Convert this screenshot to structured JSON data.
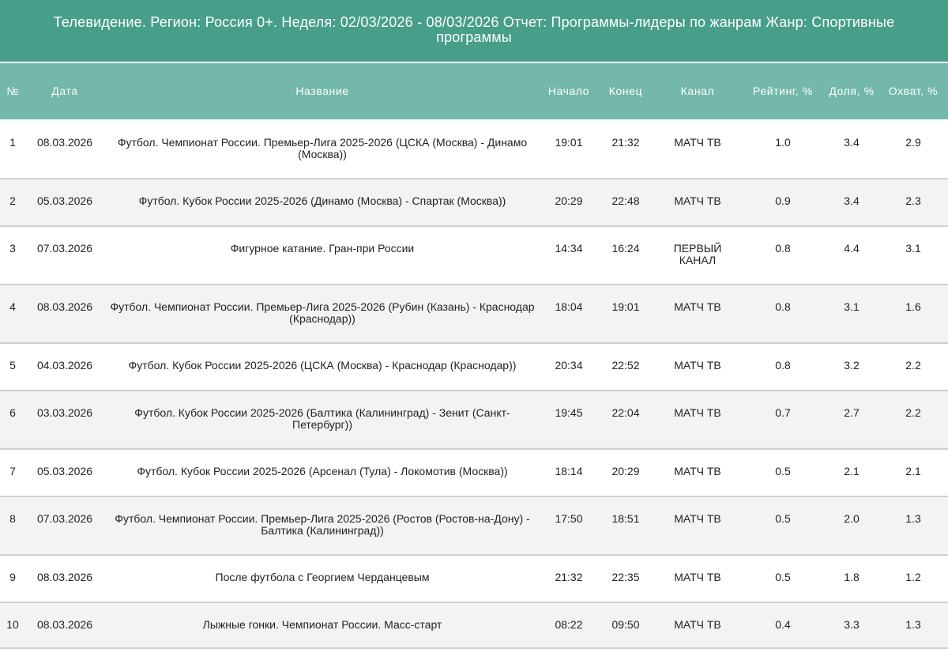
{
  "title": "Телевидение. Регион: Россия 0+. Неделя: 02/03/2026 - 08/03/2026 Отчет: Программы-лидеры по жанрам Жанр: Спортивные программы",
  "colors": {
    "title_bg": "#479f8a",
    "header_bg": "#73b8aa",
    "row_alt_bg": "#f3f3f3",
    "divider": "#d0d0d0"
  },
  "columns": {
    "num": "№",
    "date": "Дата",
    "name": "Название",
    "start": "Начало",
    "end": "Конец",
    "channel": "Канал",
    "rating": "Рейтинг, %",
    "share": "Доля, %",
    "reach": "Охват, %"
  },
  "rows": [
    {
      "num": "1",
      "date": "08.03.2026",
      "name": "Футбол. Чемпионат России. Премьер-Лига 2025-2026 (ЦСКА (Москва) - Динамо (Москва))",
      "start": "19:01",
      "end": "21:32",
      "channel": "МАТЧ ТВ",
      "rating": "1.0",
      "share": "3.4",
      "reach": "2.9"
    },
    {
      "num": "2",
      "date": "05.03.2026",
      "name": "Футбол. Кубок России 2025-2026 (Динамо (Москва) - Спартак (Москва))",
      "start": "20:29",
      "end": "22:48",
      "channel": "МАТЧ ТВ",
      "rating": "0.9",
      "share": "3.4",
      "reach": "2.3"
    },
    {
      "num": "3",
      "date": "07.03.2026",
      "name": "Фигурное катание. Гран-при России",
      "start": "14:34",
      "end": "16:24",
      "channel": "ПЕРВЫЙ КАНАЛ",
      "rating": "0.8",
      "share": "4.4",
      "reach": "3.1"
    },
    {
      "num": "4",
      "date": "08.03.2026",
      "name": "Футбол. Чемпионат России. Премьер-Лига 2025-2026 (Рубин (Казань) - Краснодар (Краснодар))",
      "start": "18:04",
      "end": "19:01",
      "channel": "МАТЧ ТВ",
      "rating": "0.8",
      "share": "3.1",
      "reach": "1.6"
    },
    {
      "num": "5",
      "date": "04.03.2026",
      "name": "Футбол. Кубок России 2025-2026 (ЦСКА (Москва) - Краснодар (Краснодар))",
      "start": "20:34",
      "end": "22:52",
      "channel": "МАТЧ ТВ",
      "rating": "0.8",
      "share": "3.2",
      "reach": "2.2"
    },
    {
      "num": "6",
      "date": "03.03.2026",
      "name": "Футбол. Кубок России 2025-2026 (Балтика (Калининград) - Зенит (Санкт-Петербург))",
      "start": "19:45",
      "end": "22:04",
      "channel": "МАТЧ ТВ",
      "rating": "0.7",
      "share": "2.7",
      "reach": "2.2"
    },
    {
      "num": "7",
      "date": "05.03.2026",
      "name": "Футбол. Кубок России 2025-2026 (Арсенал (Тула) - Локомотив (Москва))",
      "start": "18:14",
      "end": "20:29",
      "channel": "МАТЧ ТВ",
      "rating": "0.5",
      "share": "2.1",
      "reach": "2.1"
    },
    {
      "num": "8",
      "date": "07.03.2026",
      "name": "Футбол. Чемпионат России. Премьер-Лига 2025-2026 (Ростов (Ростов-на-Дону) - Балтика (Калининград))",
      "start": "17:50",
      "end": "18:51",
      "channel": "МАТЧ ТВ",
      "rating": "0.5",
      "share": "2.0",
      "reach": "1.3"
    },
    {
      "num": "9",
      "date": "08.03.2026",
      "name": "После футбола с Георгием Черданцевым",
      "start": "21:32",
      "end": "22:35",
      "channel": "МАТЧ ТВ",
      "rating": "0.5",
      "share": "1.8",
      "reach": "1.2"
    },
    {
      "num": "10",
      "date": "08.03.2026",
      "name": "Лыжные гонки. Чемпионат России. Масс-старт",
      "start": "08:22",
      "end": "09:50",
      "channel": "МАТЧ ТВ",
      "rating": "0.4",
      "share": "3.3",
      "reach": "1.3"
    }
  ]
}
